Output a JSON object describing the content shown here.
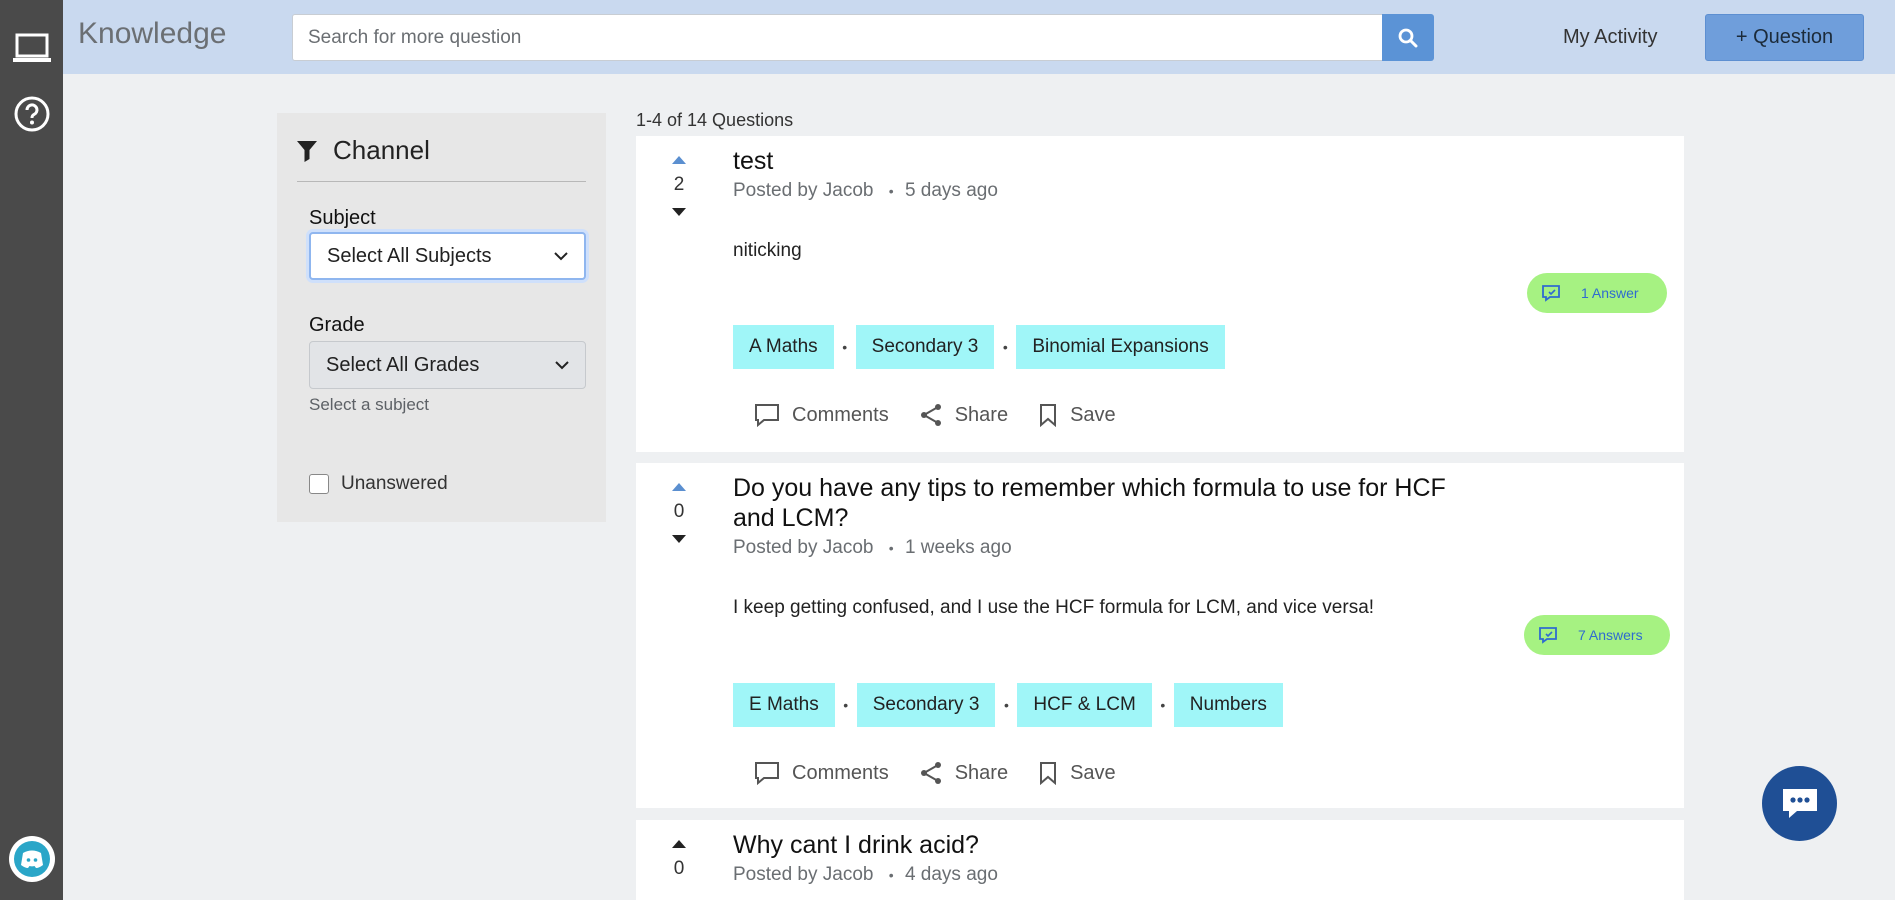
{
  "app": {
    "brand": "Knowledge",
    "search_placeholder": "Search for more question",
    "my_activity": "My Activity",
    "ask_button": "+ Question"
  },
  "filter": {
    "title": "Channel",
    "subject_label": "Subject",
    "subject_value": "Select All Subjects",
    "grade_label": "Grade",
    "grade_value": "Select All Grades",
    "grade_hint": "Select a subject",
    "unanswered_label": "Unanswered"
  },
  "results": {
    "count_text": "1-4 of 14 Questions",
    "questions": [
      {
        "votes": "2",
        "title": "test",
        "author": "Posted by Jacob",
        "time": "5 days ago",
        "body": "niticking",
        "answers": "1 Answer",
        "tags": [
          "A Maths",
          "Secondary 3",
          "Binomial Expansions"
        ],
        "actions": [
          "Comments",
          "Share",
          "Save"
        ]
      },
      {
        "votes": "0",
        "title": "Do you have any tips to remember which formula to use for HCF and LCM?",
        "author": "Posted by Jacob",
        "time": "1 weeks ago",
        "body": "I keep getting confused, and I use the HCF formula for LCM, and vice versa!",
        "answers": "7 Answers",
        "tags": [
          "E Maths",
          "Secondary 3",
          "HCF & LCM",
          "Numbers"
        ],
        "actions": [
          "Comments",
          "Share",
          "Save"
        ]
      },
      {
        "votes": "0",
        "title": "Why cant I drink acid?",
        "author": "Posted by Jacob",
        "time": "4 days ago"
      }
    ]
  },
  "colors": {
    "topbar": "#c9d9ef",
    "rail": "#4a4a4a",
    "accent": "#5b93d6",
    "tag_bg": "#a0f6f8",
    "answer_pill": "#a6f282",
    "chat_fab": "#1f4f95"
  }
}
